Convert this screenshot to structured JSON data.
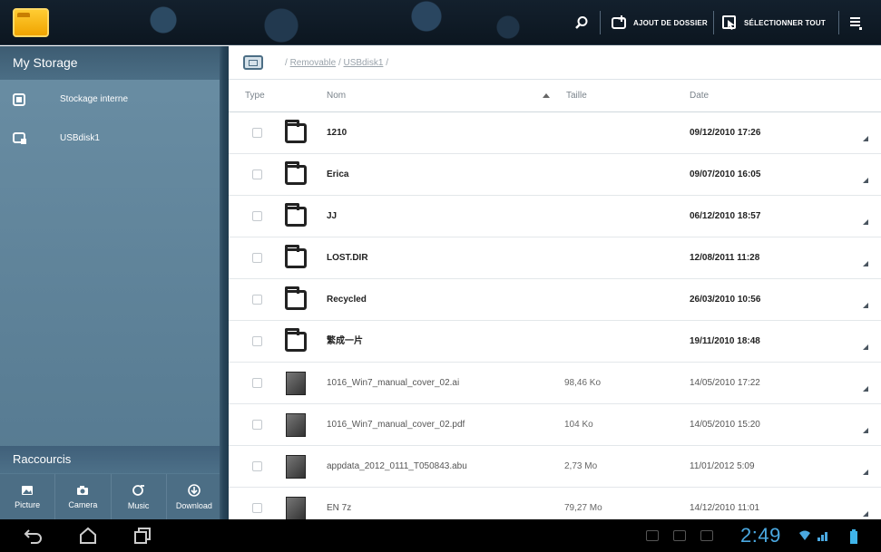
{
  "topbar": {
    "search_icon": "search-icon",
    "add_folder_label": "AJOUT DE DOSSIER",
    "select_all_label": "SÉLECTIONNER TOUT",
    "menu_icon": "overflow-menu-icon"
  },
  "sidebar": {
    "title": "My Storage",
    "items": [
      {
        "label": "Stockage interne",
        "icon": "internal-storage-icon"
      },
      {
        "label": "USBdisk1",
        "icon": "usb-disk-icon"
      }
    ],
    "shortcuts_title": "Raccourcis",
    "shortcuts": [
      {
        "label": "Picture",
        "icon": "picture-icon"
      },
      {
        "label": "Camera",
        "icon": "camera-icon"
      },
      {
        "label": "Music",
        "icon": "music-icon"
      },
      {
        "label": "Download",
        "icon": "download-icon"
      }
    ]
  },
  "main": {
    "breadcrumb": {
      "sep1": "/",
      "part1": "Removable",
      "sep2": "/",
      "part2": "USBdisk1",
      "sep3": "/"
    },
    "columns": {
      "type": "Type",
      "name": "Nom",
      "size": "Taille",
      "date": "Date"
    },
    "rows": [
      {
        "kind": "folder",
        "name": "1210",
        "size": "",
        "date": "09/12/2010 17:26"
      },
      {
        "kind": "folder",
        "name": "Erica",
        "size": "",
        "date": "09/07/2010 16:05"
      },
      {
        "kind": "folder",
        "name": "JJ",
        "size": "",
        "date": "06/12/2010 18:57"
      },
      {
        "kind": "folder",
        "name": "LOST.DIR",
        "size": "",
        "date": "12/08/2011 11:28"
      },
      {
        "kind": "folder",
        "name": "Recycled",
        "size": "",
        "date": "26/03/2010 10:56"
      },
      {
        "kind": "folder",
        "name": "繁成一片",
        "size": "",
        "date": "19/11/2010 18:48"
      },
      {
        "kind": "file",
        "name": "1016_Win7_manual_cover_02.ai",
        "size": "98,46 Ko",
        "date": "14/05/2010 17:22"
      },
      {
        "kind": "file",
        "name": "1016_Win7_manual_cover_02.pdf",
        "size": "104 Ko",
        "date": "14/05/2010 15:20"
      },
      {
        "kind": "file",
        "name": "appdata_2012_0111_T050843.abu",
        "size": "2,73 Mo",
        "date": "11/01/2012 5:09"
      },
      {
        "kind": "file",
        "name": "EN 7z",
        "size": "79,27 Mo",
        "date": "14/12/2010 11:01"
      }
    ]
  },
  "systembar": {
    "time": "2:49",
    "colors": {
      "clock": "#4aa8e0",
      "battery": "#3fb4ea"
    }
  }
}
